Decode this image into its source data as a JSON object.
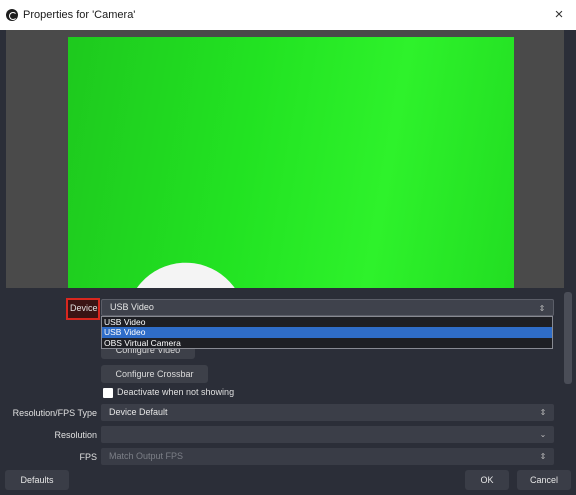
{
  "window": {
    "title": "Properties for 'Camera'",
    "close_glyph": "×",
    "app_icon": "obs-logo-icon"
  },
  "preview": {
    "description_colors": {
      "background": "#4a4a4a",
      "green_screen": "#22e322"
    }
  },
  "form": {
    "device_label": "Device",
    "device_value": "USB Video",
    "device_options": [
      "USB Video",
      "USB Video",
      "OBS Virtual Camera"
    ],
    "device_selected_index": 1,
    "configure_video_label": "Configure Video",
    "configure_crossbar_label": "Configure Crossbar",
    "deactivate_label": "Deactivate when not showing",
    "deactivate_checked": false,
    "resolution_fps_type_label": "Resolution/FPS Type",
    "resolution_fps_type_value": "Device Default",
    "resolution_label": "Resolution",
    "resolution_value": "",
    "fps_label": "FPS",
    "fps_value": "Match Output FPS"
  },
  "footer": {
    "defaults_label": "Defaults",
    "ok_label": "OK",
    "cancel_label": "Cancel"
  },
  "colors": {
    "accent_selection": "#2f6dc8",
    "highlight_border": "#d9271f",
    "dialog_background": "#2b2e38"
  }
}
